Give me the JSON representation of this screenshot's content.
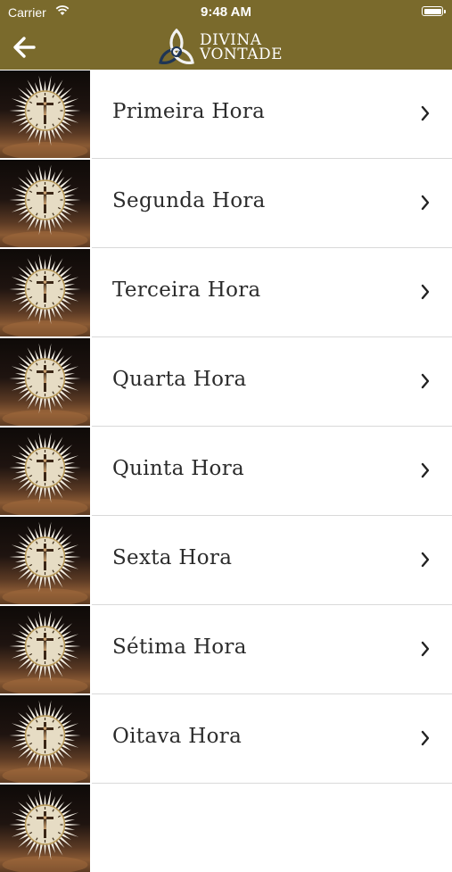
{
  "status_bar": {
    "carrier": "Carrier",
    "time": "9:48 AM",
    "wifi_icon": "wifi-icon",
    "battery_icon": "battery-icon"
  },
  "nav": {
    "back_icon": "arrow-left-icon",
    "logo_line1": "DIVINA",
    "logo_line2": "VONTADE",
    "header_color": "#7a6a2c"
  },
  "items": [
    {
      "label": "Primeira Hora"
    },
    {
      "label": "Segunda Hora"
    },
    {
      "label": "Terceira Hora"
    },
    {
      "label": "Quarta Hora"
    },
    {
      "label": "Quinta Hora"
    },
    {
      "label": "Sexta Hora"
    },
    {
      "label": "Sétima Hora"
    },
    {
      "label": "Oitava Hora"
    }
  ],
  "icons": {
    "item_thumbnail": "crucifix-clock-thumbnail",
    "item_chevron": "chevron-right-icon"
  }
}
